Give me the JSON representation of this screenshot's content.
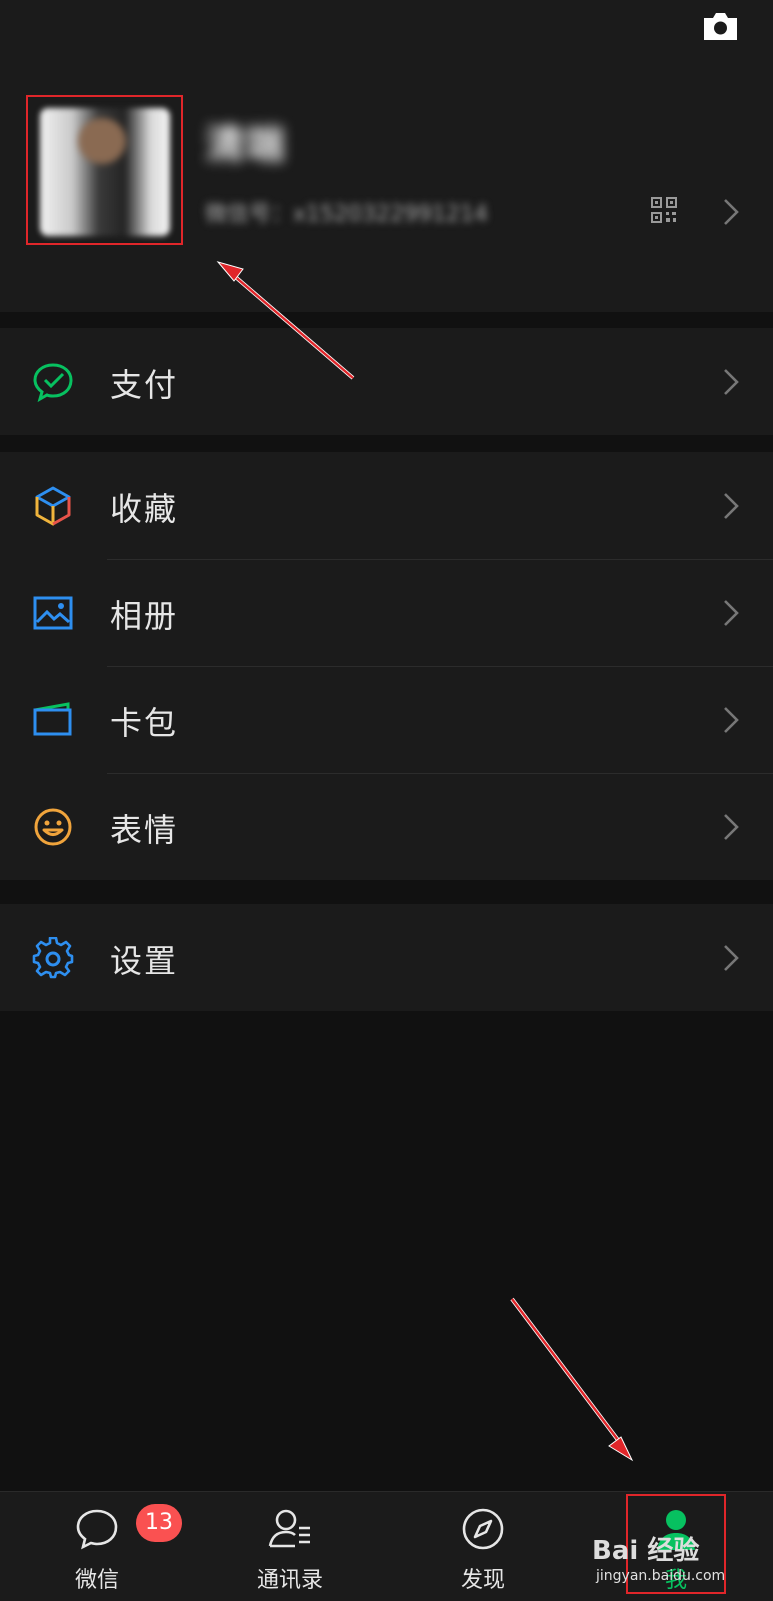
{
  "profile": {
    "name": "清端",
    "wechat_id": "微信号：x1520322991214"
  },
  "menu": {
    "pay": "支付",
    "favorites": "收藏",
    "album": "相册",
    "cards": "卡包",
    "stickers": "表情",
    "settings": "设置"
  },
  "tabs": [
    {
      "label": "微信",
      "badge": "13",
      "icon": "chat-bubble-icon"
    },
    {
      "label": "通讯录",
      "icon": "contacts-icon"
    },
    {
      "label": "发现",
      "icon": "compass-icon"
    },
    {
      "label": "我",
      "icon": "me-person-icon"
    }
  ],
  "watermark": {
    "logo": "Bai 经验",
    "url": "jingyan.baidu.com"
  },
  "colors": {
    "accent": "#07c160",
    "badge": "#fa5151",
    "annotation": "#e0262a"
  }
}
